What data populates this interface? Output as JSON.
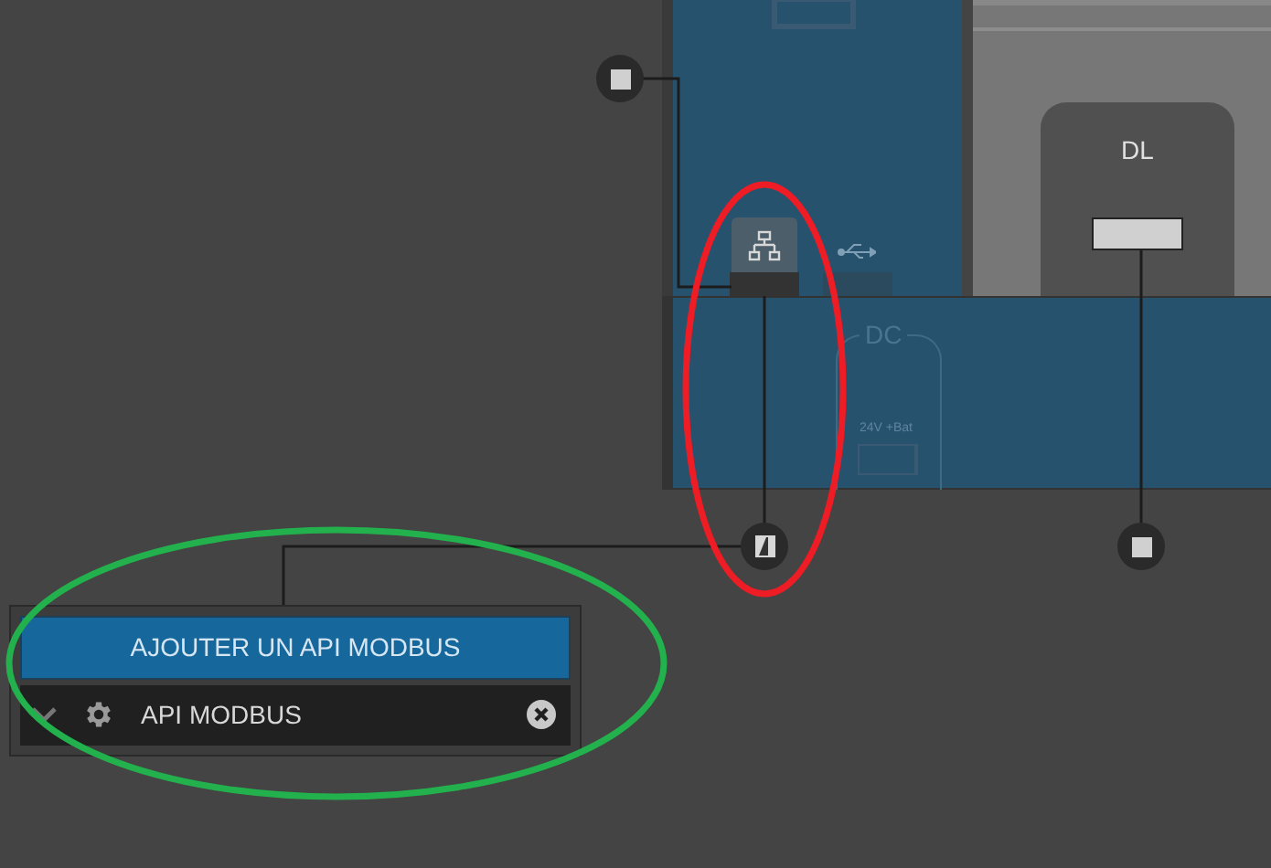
{
  "device": {
    "module_label": "DL",
    "power_label": "DC",
    "terminal_label": "24V +Bat"
  },
  "nodes": [
    {
      "kind": "square"
    },
    {
      "kind": "port"
    },
    {
      "kind": "square"
    }
  ],
  "api_panel": {
    "add_button": "AJOUTER UN API MODBUS",
    "items": [
      {
        "label": "API MODBUS",
        "expanded": false
      }
    ]
  },
  "annotations": [
    {
      "kind": "ellipse",
      "color": "#ee1c24"
    },
    {
      "kind": "ellipse",
      "color": "#22b14c"
    }
  ]
}
